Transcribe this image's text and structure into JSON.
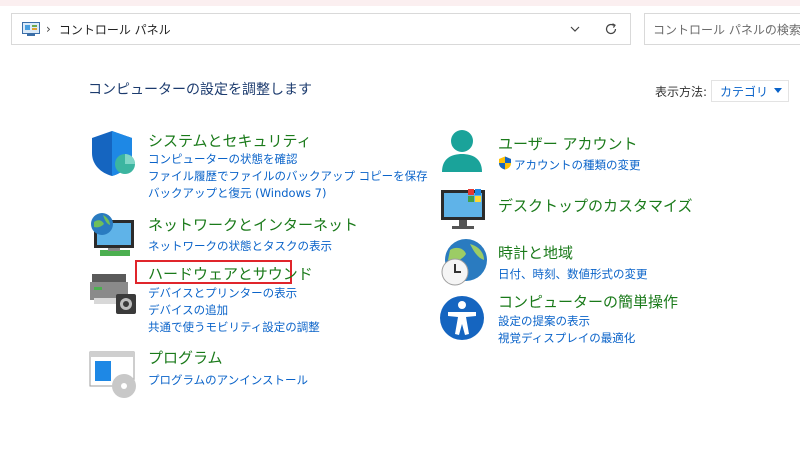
{
  "address_bar": {
    "separator": "›",
    "path": "コントロール パネル"
  },
  "search": {
    "placeholder": "コントロール パネルの検索"
  },
  "page_title": "コンピューターの設定を調整します",
  "view_by": {
    "label": "表示方法:",
    "value": "カテゴリ"
  },
  "categories": [
    {
      "title": "システムとセキュリティ",
      "links": [
        "コンピューターの状態を確認",
        "ファイル履歴でファイルのバックアップ コピーを保存",
        "バックアップと復元 (Windows 7)"
      ]
    },
    {
      "title": "ネットワークとインターネット",
      "links": [
        "ネットワークの状態とタスクの表示"
      ]
    },
    {
      "title": "ハードウェアとサウンド",
      "links": [
        "デバイスとプリンターの表示",
        "デバイスの追加",
        "共通で使うモビリティ設定の調整"
      ]
    },
    {
      "title": "プログラム",
      "links": [
        "プログラムのアンインストール"
      ]
    },
    {
      "title": "ユーザー アカウント",
      "links": [
        "アカウントの種類の変更"
      ]
    },
    {
      "title": "デスクトップのカスタマイズ",
      "links": []
    },
    {
      "title": "時計と地域",
      "links": [
        "日付、時刻、数値形式の変更"
      ]
    },
    {
      "title": "コンピューターの簡単操作",
      "links": [
        "設定の提案の表示",
        "視覚ディスプレイの最適化"
      ]
    }
  ],
  "colors": {
    "title_green": "#1a7a1a",
    "link_blue": "#0a63c9",
    "highlight_red": "#e0252b"
  }
}
